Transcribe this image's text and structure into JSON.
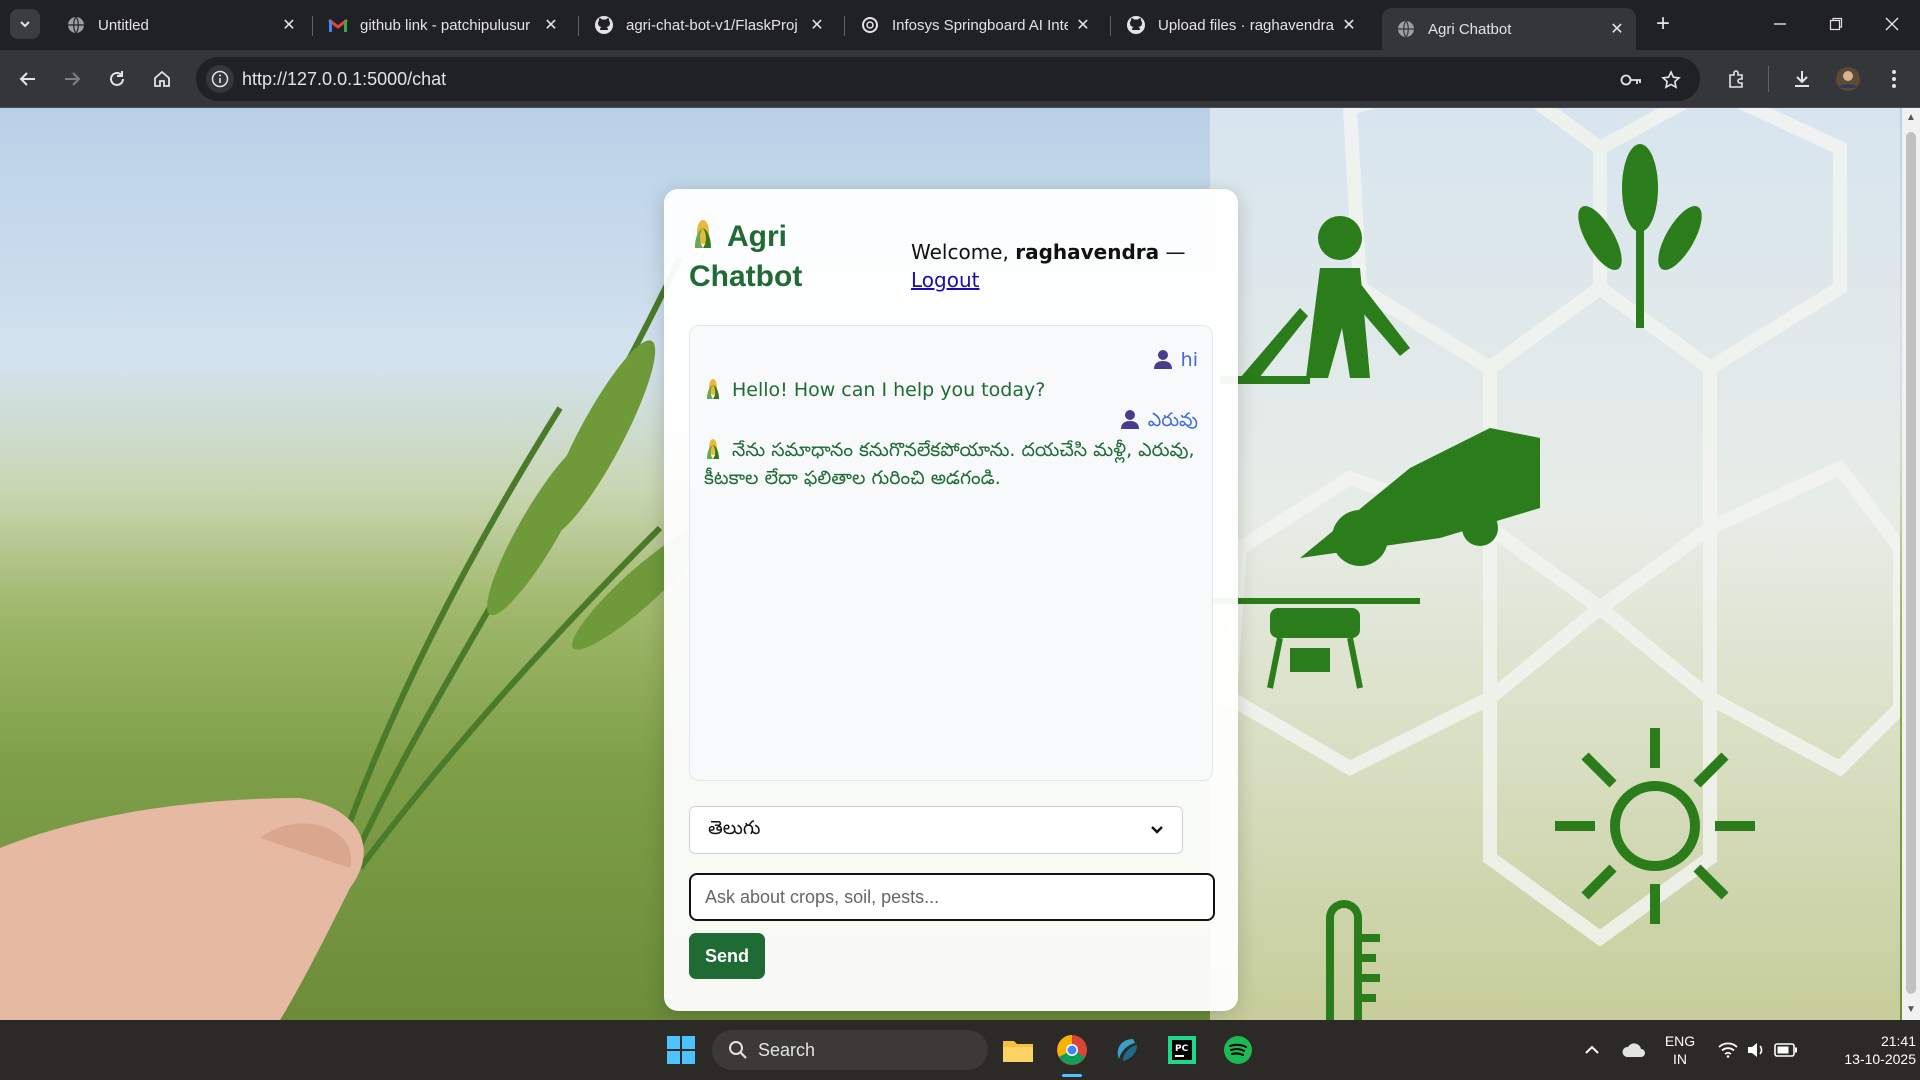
{
  "browser": {
    "tabs": [
      {
        "title": "Untitled",
        "icon": "globe-icon"
      },
      {
        "title": "github link - patchipulusur",
        "icon": "gmail-icon"
      },
      {
        "title": "agri-chat-bot-v1/FlaskProj",
        "icon": "github-icon"
      },
      {
        "title": "Infosys Springboard AI Inte",
        "icon": "openai-icon"
      },
      {
        "title": "Upload files · raghavendra",
        "icon": "github-icon"
      },
      {
        "title": "Agri Chatbot",
        "icon": "globe-icon"
      }
    ],
    "url": "http://127.0.0.1:5000/chat"
  },
  "app": {
    "brand_line1": "Agri",
    "brand_line2": "Chatbot",
    "welcome_prefix": "Welcome, ",
    "username": "raghavendra",
    "welcome_dash": " —",
    "logout_label": "Logout"
  },
  "chat": {
    "messages": [
      {
        "role": "user",
        "text": "hi"
      },
      {
        "role": "bot",
        "text": "Hello! How can I help you today?"
      },
      {
        "role": "user",
        "text": "ఎరువు"
      },
      {
        "role": "bot",
        "text": "నేను సమాధానం కనుగొనలేకపోయాను. దయచేసి మళ్లీ, ఎరువు, కీటకాల లేదా ఫలితాల గురించి అడగండి."
      }
    ]
  },
  "form": {
    "language_selected": "తెలుగు",
    "input_placeholder": "Ask about crops, soil, pests...",
    "send_label": "Send"
  },
  "taskbar": {
    "search_label": "Search",
    "lang_line1": "ENG",
    "lang_line2": "IN",
    "time": "21:41",
    "date": "13-10-2025"
  },
  "colors": {
    "brand_green": "#1f6b34",
    "user_blue": "#3f6ad8",
    "icon_green": "#2a7d1a"
  }
}
